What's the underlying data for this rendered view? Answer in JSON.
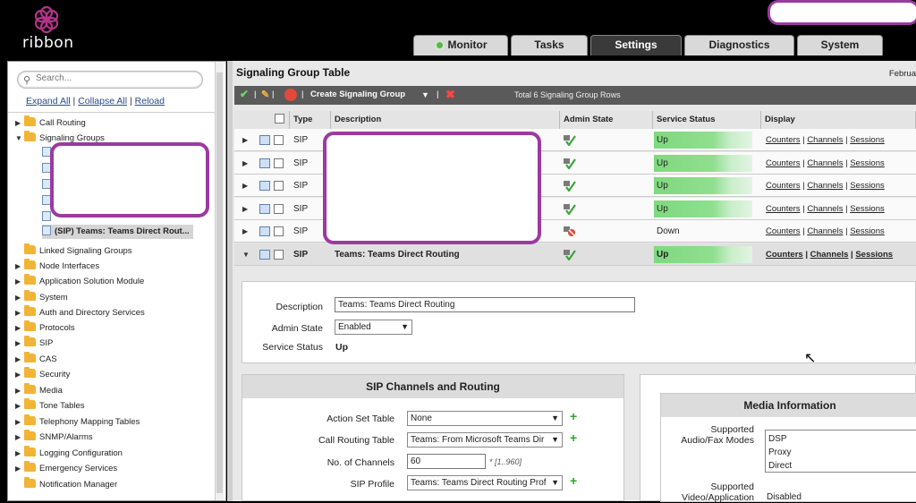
{
  "brand": {
    "logo_text": "ribbon"
  },
  "nav": {
    "tabs": [
      {
        "label": "Monitor"
      },
      {
        "label": "Tasks"
      },
      {
        "label": "Settings"
      },
      {
        "label": "Diagnostics"
      },
      {
        "label": "System"
      }
    ],
    "active": "Settings"
  },
  "sidebar": {
    "search_placeholder": "Search...",
    "links": {
      "expand_all": "Expand All",
      "collapse_all": "Collapse All",
      "reload": "Reload"
    },
    "items": [
      {
        "label": "Call Routing"
      },
      {
        "label": "Signaling Groups"
      },
      {
        "label": "Linked Signaling Groups"
      },
      {
        "label": "Node Interfaces"
      },
      {
        "label": "Application Solution Module"
      },
      {
        "label": "System"
      },
      {
        "label": "Auth and Directory Services"
      },
      {
        "label": "Protocols"
      },
      {
        "label": "SIP"
      },
      {
        "label": "CAS"
      },
      {
        "label": "Security"
      },
      {
        "label": "Media"
      },
      {
        "label": "Tone Tables"
      },
      {
        "label": "Telephony Mapping Tables"
      },
      {
        "label": "SNMP/Alarms"
      },
      {
        "label": "Logging Configuration"
      },
      {
        "label": "Emergency Services"
      },
      {
        "label": "Notification Manager"
      }
    ],
    "selected_child": "(SIP) Teams: Teams Direct Rout..."
  },
  "main": {
    "title": "Signaling Group Table",
    "date": "Februa",
    "toolbar": {
      "create_label": "Create Signaling Group",
      "total": "Total 6 Signaling Group Rows"
    },
    "columns": [
      "Type",
      "Description",
      "Admin State",
      "Service Status",
      "Display"
    ],
    "display_links": {
      "counters": "Counters",
      "channels": "Channels",
      "sessions": "Sessions"
    },
    "rows": [
      {
        "type": "SIP",
        "description": "",
        "status": "Up",
        "admin": "enabled"
      },
      {
        "type": "SIP",
        "description": "",
        "status": "Up",
        "admin": "enabled"
      },
      {
        "type": "SIP",
        "description": "",
        "status": "Up",
        "admin": "enabled"
      },
      {
        "type": "SIP",
        "description": "",
        "status": "Up",
        "admin": "enabled"
      },
      {
        "type": "SIP",
        "description": "",
        "status": "Down",
        "admin": "disabled"
      },
      {
        "type": "SIP",
        "description": "Teams: Teams Direct Routing",
        "status": "Up",
        "admin": "enabled"
      }
    ]
  },
  "detail": {
    "description_label": "Description",
    "description_value": "Teams: Teams Direct Routing",
    "admin_state_label": "Admin State",
    "admin_state_value": "Enabled",
    "service_status_label": "Service Status",
    "service_status_value": "Up"
  },
  "sip_panel": {
    "title": "SIP Channels and Routing",
    "action_set_label": "Action Set Table",
    "action_set_value": "None",
    "call_routing_label": "Call Routing Table",
    "call_routing_value": "Teams: From Microsoft Teams Dir",
    "channels_label": "No. of Channels",
    "channels_value": "60",
    "channels_hint": "* [1..960]",
    "sip_profile_label": "SIP Profile",
    "sip_profile_value": "Teams: Teams Direct Routing Prof"
  },
  "media_panel": {
    "title": "Media Information",
    "audio_label": "Supported\nAudio/Fax Modes",
    "audio_options": [
      "DSP",
      "Proxy",
      "Direct"
    ],
    "video_label": "Supported\nVideo/Application",
    "video_value": "Disabled"
  },
  "colors": {
    "accent_green": "#55b94a",
    "redaction_border": "#9b3aa0",
    "status_up": "#7fd97f"
  }
}
